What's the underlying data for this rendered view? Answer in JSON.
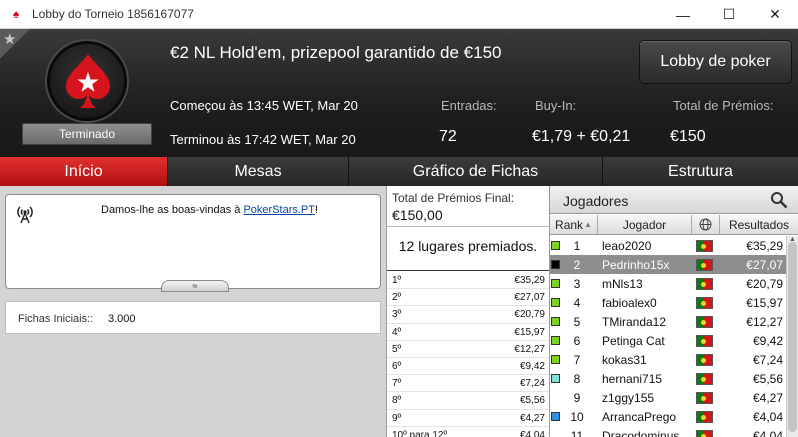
{
  "window": {
    "title": "Lobby do Torneio 1856167077",
    "minimize": "—",
    "maximize": "☐",
    "close": "✕"
  },
  "header": {
    "tournament_name": "€2 NL Hold'em, prizepool garantido de €150",
    "status": "Terminado",
    "lobby_button": "Lobby de poker",
    "started": "Começou às 13:45 WET, Mar 20",
    "ended": "Terminou às 17:42 WET, Mar 20",
    "entries_label": "Entradas:",
    "entries_value": "72",
    "buyin_label": "Buy-In:",
    "buyin_value": "€1,79 + €0,21",
    "total_prize_label": "Total de Prémios:",
    "total_prize_value": "€150"
  },
  "tabs": [
    {
      "label": "Início",
      "active": true
    },
    {
      "label": "Mesas",
      "active": false
    },
    {
      "label": "Gráfico de Fichas",
      "active": false
    },
    {
      "label": "Estrutura",
      "active": false
    }
  ],
  "welcome": {
    "text": "Damos-lhe as boas-vindas à ",
    "link": "PokerStars.PT",
    "suffix": "!",
    "expand": "≈"
  },
  "chips": {
    "label": "Fichas Iniciais::",
    "value": "3.000"
  },
  "prizes": {
    "title": "Total de Prémios Final:",
    "total": "€150,00",
    "places": "12 lugares premiados.",
    "rows": [
      {
        "place": "1º",
        "amount": "€35,29"
      },
      {
        "place": "2º",
        "amount": "€27,07"
      },
      {
        "place": "3º",
        "amount": "€20,79"
      },
      {
        "place": "4º",
        "amount": "€15,97"
      },
      {
        "place": "5º",
        "amount": "€12,27"
      },
      {
        "place": "6º",
        "amount": "€9,42"
      },
      {
        "place": "7º",
        "amount": "€7,24"
      },
      {
        "place": "8º",
        "amount": "€5,56"
      },
      {
        "place": "9º",
        "amount": "€4,27"
      },
      {
        "place": "10º para 12º",
        "amount": "€4,04"
      }
    ]
  },
  "players": {
    "title": "Jogadores",
    "columns": {
      "rank": "Rank",
      "player": "Jogador",
      "results": "Resultados"
    },
    "rows": [
      {
        "rank": "1",
        "name": "leao2020",
        "result": "€35,29",
        "color": "#7ed321"
      },
      {
        "rank": "2",
        "name": "Pedrinho15x",
        "result": "€27,07",
        "color": "#000000",
        "selected": true
      },
      {
        "rank": "3",
        "name": "mNls13",
        "result": "€20,79",
        "color": "#7ed321"
      },
      {
        "rank": "4",
        "name": "fabioalex0",
        "result": "€15,97",
        "color": "#7ed321"
      },
      {
        "rank": "5",
        "name": "TMiranda12",
        "result": "€12,27",
        "color": "#7ed321"
      },
      {
        "rank": "6",
        "name": "Petinga Cat",
        "result": "€9,42",
        "color": "#7ed321"
      },
      {
        "rank": "7",
        "name": "kokas31",
        "result": "€7,24",
        "color": "#7ed321"
      },
      {
        "rank": "8",
        "name": "hernani715",
        "result": "€5,56",
        "color": "#7fe0d6"
      },
      {
        "rank": "9",
        "name": "z1ggy155",
        "result": "€4,27",
        "color": ""
      },
      {
        "rank": "10",
        "name": "ArrancaPrego",
        "result": "€4,04",
        "color": "#2f8fe0"
      },
      {
        "rank": "11",
        "name": "Dracodominus",
        "result": "€4,04",
        "color": ""
      }
    ]
  },
  "colors": {
    "accent": "#c41414",
    "header_bg": "#1e1e1e",
    "selected_row": "#8e8e8e"
  }
}
